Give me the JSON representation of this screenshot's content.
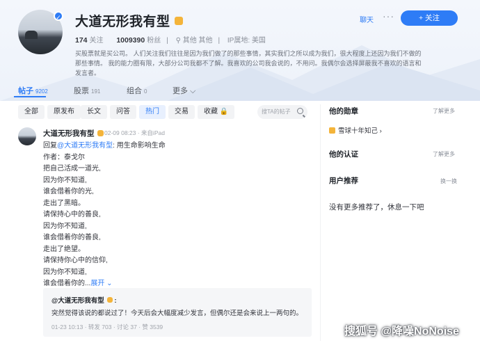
{
  "profile": {
    "name": "大道无形我有型",
    "following_count": "174",
    "following_label": "关注",
    "followers_count": "1009390",
    "followers_label": "粉丝",
    "location": "其他 其他",
    "ip_label": "IP属地: 美国",
    "bio": "买股票就是买公司。 人们关注我们往往是因为我们做了的那些事情，其实我们之所以成为我们，很大程度上还因为我们不做的那些事情。 我的能力圈有限，大部分公司我都不了解。我喜欢的公司我会说的，不用问。我偶尔会选择屏蔽我不喜欢的语言和发言者。",
    "chat_label": "聊天",
    "more_label": "···",
    "follow_label": "+ 关注"
  },
  "tabs": [
    {
      "label": "帖子",
      "count": "9202"
    },
    {
      "label": "股票",
      "count": "191"
    },
    {
      "label": "组合",
      "count": "0"
    },
    {
      "label": "更多 ⌵",
      "count": ""
    }
  ],
  "filters": [
    "全部",
    "原发布",
    "长文",
    "问答",
    "热门",
    "交易",
    "收藏 🔒"
  ],
  "search": {
    "placeholder": "搜TA的帖子"
  },
  "post": {
    "author": "大道无形我有型",
    "meta": "02-09 08:23 · 来自iPad",
    "reply_prefix": "回复",
    "mention": "@大道无形我有型",
    "reply_text": ": 用生命影响生命",
    "lines": [
      "作者：泰戈尔",
      "把自己活成一道光,",
      "因为你不知道,",
      "谁会借着你的光,",
      "走出了黑暗。",
      "请保持心中的善良,",
      "因为你不知道,",
      "谁会借着你的善良,",
      "走出了绝望。",
      "请保持你心中的信仰,",
      "因为你不知道,"
    ],
    "last_line": "谁会借着你的...",
    "expand_label": "展开",
    "quote": {
      "author": "@大道无形我有型",
      "text": "突然觉得该说的都说过了！今天后会大幅度减少发言，但偶尔还是会来说上一两句的。",
      "meta": "01-23 10:13 · 转发 703 · 讨论 37 · 赞 3539"
    }
  },
  "sidebar": {
    "medals_title": "他的勋章",
    "medals_link": "了解更多",
    "medal_name": "雪球十年知己 ›",
    "cert_title": "他的认证",
    "cert_link": "了解更多",
    "rec_title": "用户推荐",
    "rec_link": "换一换",
    "rec_empty": "没有更多推荐了，休息一下吧"
  },
  "watermark": "搜狐号 @降噪NoNoise",
  "colors": {
    "accent": "#2e7cf6",
    "badge": "#f4b43a"
  }
}
